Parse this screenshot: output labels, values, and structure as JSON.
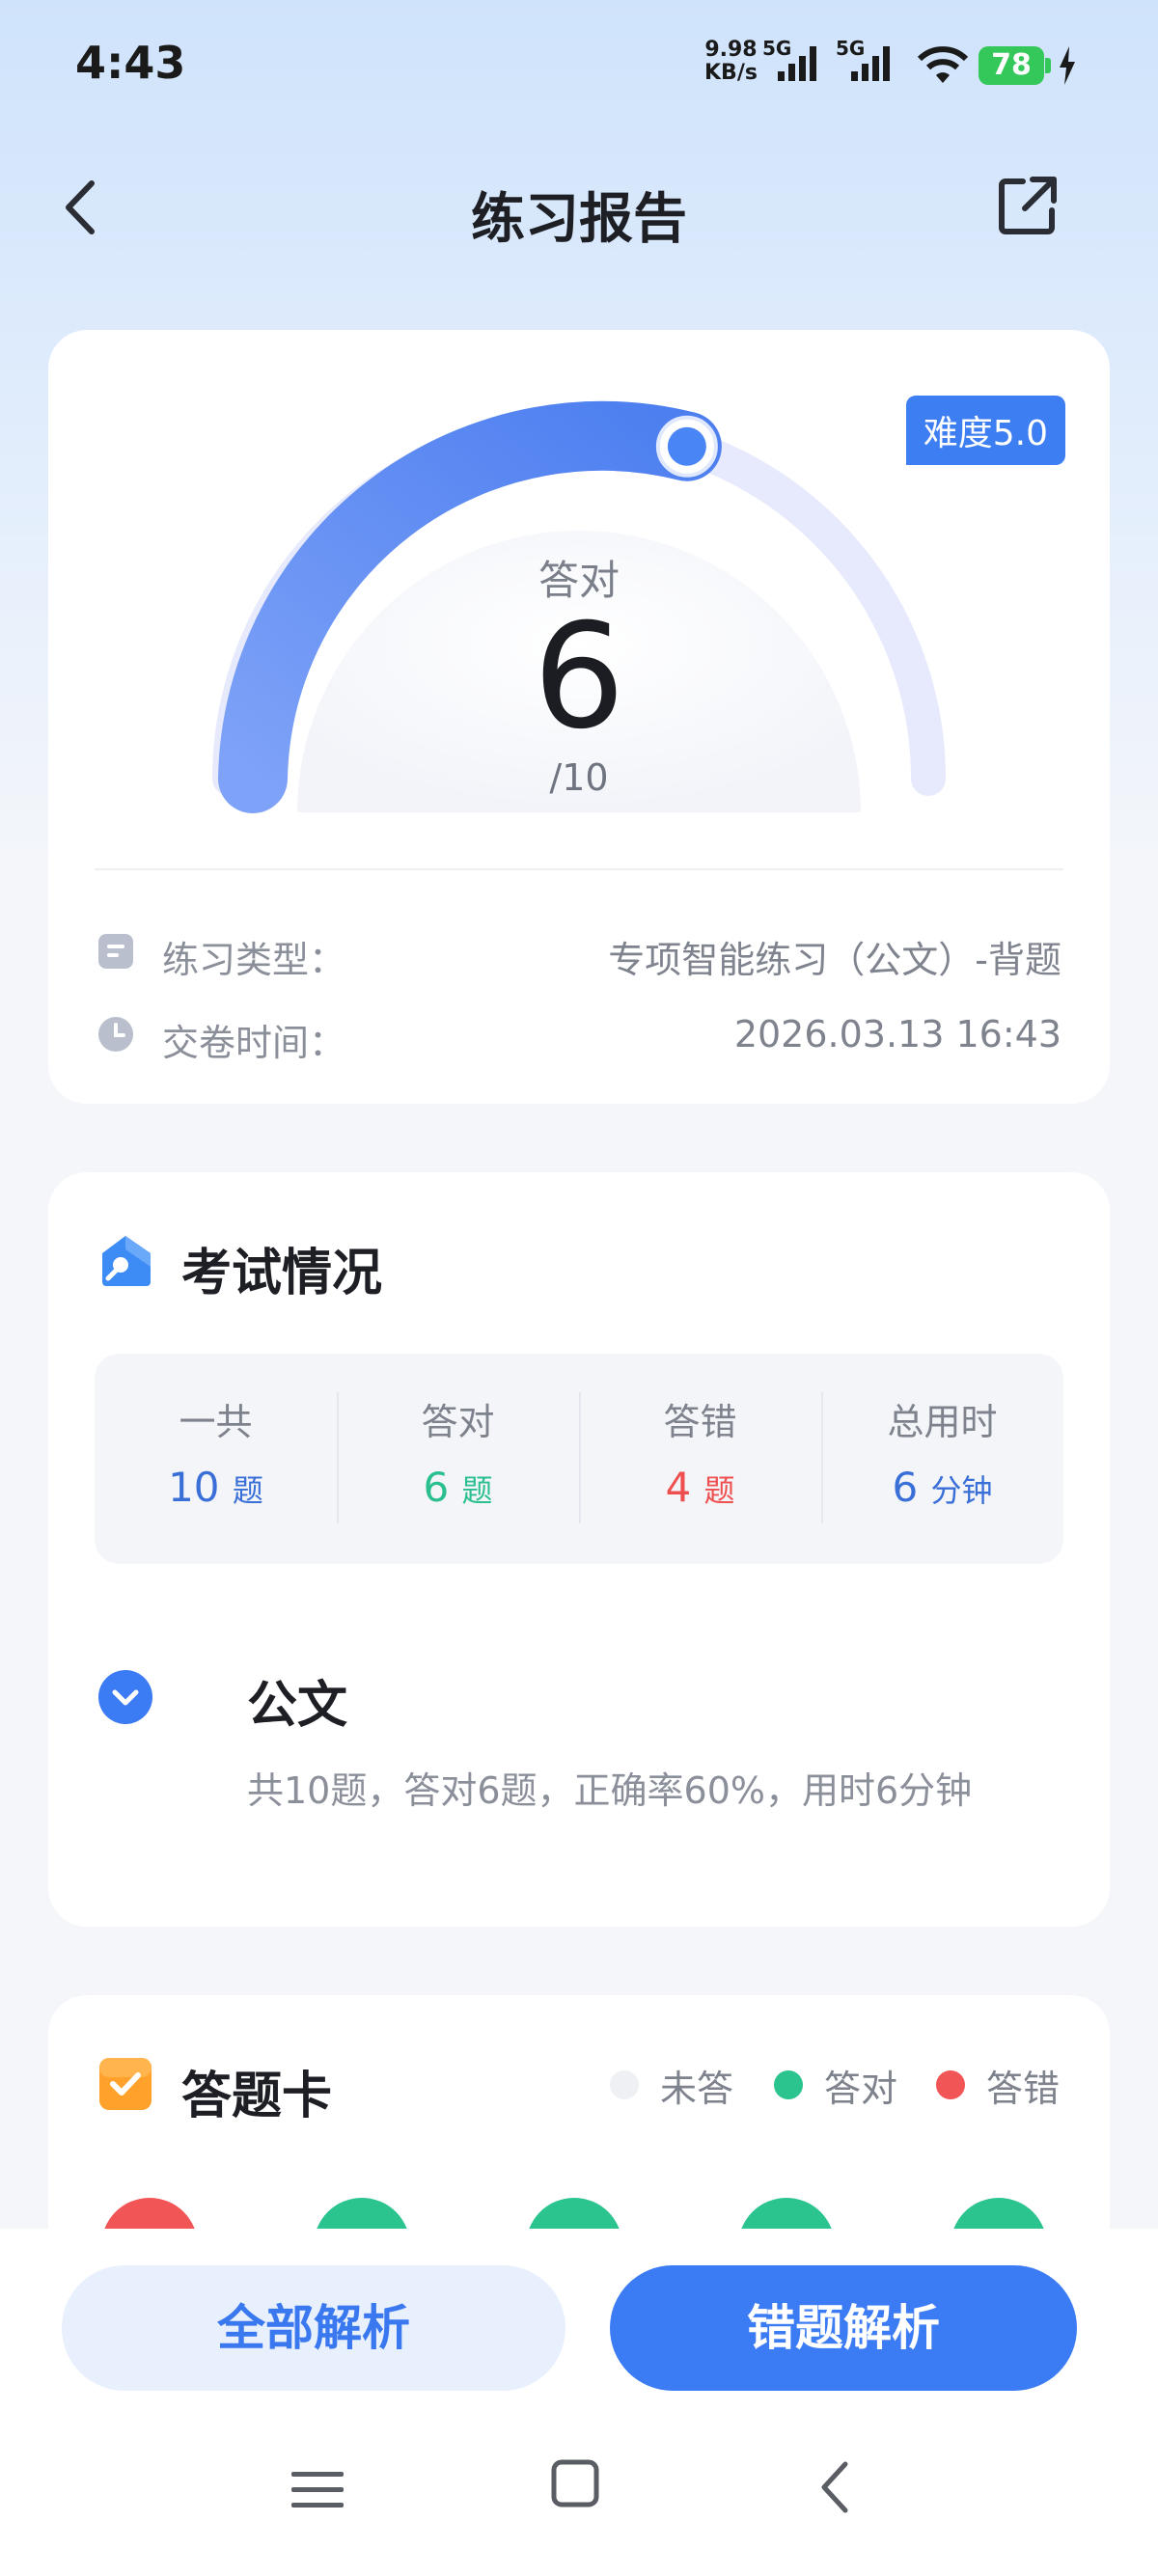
{
  "status_bar": {
    "time": "4:43",
    "net_speed_value": "9.98",
    "net_speed_unit": "KB/s",
    "signal1_label": "5G",
    "signal2_label": "5G",
    "battery": "78"
  },
  "header": {
    "title": "练习报告"
  },
  "score_card": {
    "difficulty": "难度5.0",
    "label": "答对",
    "correct": "6",
    "total_text": "/10",
    "progress": 0.6,
    "practice_type_label": "练习类型：",
    "practice_type_value": "专项智能练习（公文）-背题",
    "submit_time_label": "交卷时间：",
    "submit_time_value": "2026.03.13 16:43"
  },
  "exam_card": {
    "title": "考试情况",
    "stats": [
      {
        "label": "一共",
        "value": "10",
        "unit": "题",
        "color": "#3a6fd8"
      },
      {
        "label": "答对",
        "value": "6",
        "unit": "题",
        "color": "#2bbf8f"
      },
      {
        "label": "答错",
        "value": "4",
        "unit": "题",
        "color": "#ef4f4f"
      },
      {
        "label": "总用时",
        "value": "6",
        "unit": "分钟",
        "color": "#3a6fd8"
      }
    ],
    "subject_name": "公文",
    "subject_desc": "共10题，答对6题，正确率60%，用时6分钟"
  },
  "answer_card": {
    "title": "答题卡",
    "legend": [
      {
        "label": "未答",
        "color": "#eef0f4"
      },
      {
        "label": "答对",
        "color": "#2bc48f"
      },
      {
        "label": "答错",
        "color": "#f25555"
      }
    ],
    "answers": [
      "wrong",
      "right",
      "right",
      "right",
      "right"
    ]
  },
  "actions": {
    "all_analysis": "全部解析",
    "wrong_analysis": "错题解析"
  },
  "colors": {
    "accent": "#3b7bf4",
    "correct": "#2bc48f",
    "wrong": "#f25555"
  }
}
